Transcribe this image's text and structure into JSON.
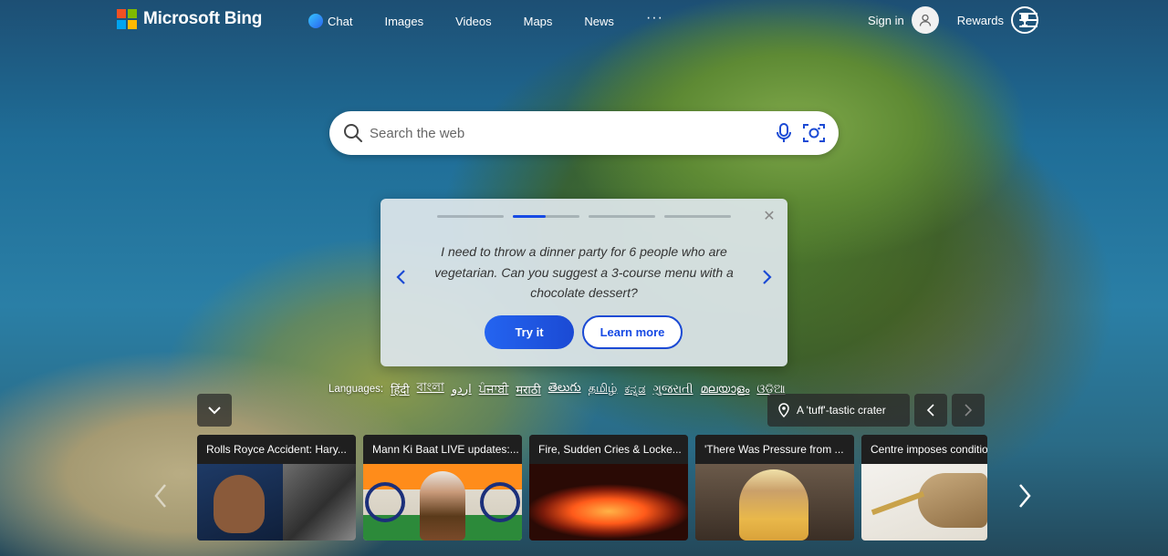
{
  "header": {
    "brand": "Microsoft Bing",
    "nav": [
      {
        "label": "Chat",
        "icon": "chat-icon"
      },
      {
        "label": "Images"
      },
      {
        "label": "Videos"
      },
      {
        "label": "Maps"
      },
      {
        "label": "News"
      },
      {
        "label": "···"
      }
    ],
    "signin_label": "Sign in",
    "rewards_label": "Rewards"
  },
  "search": {
    "placeholder": "Search the web"
  },
  "suggestion_card": {
    "text": "I need to throw a dinner party for 6 people who are vegetarian. Can you suggest a 3-course menu with a chocolate dessert?",
    "try_label": "Try it",
    "learn_label": "Learn more",
    "progress_steps": 4,
    "active_step": 2
  },
  "languages": {
    "label": "Languages:",
    "items": [
      "हिंदी",
      "বাংলা",
      "اردو",
      "ਪੰਜਾਬੀ",
      "मराठी",
      "తెలుగు",
      "தமிழ்",
      "ಕನ್ನಡ",
      "ગુજરાતી",
      "മലയാളം",
      "ଓଡ଼ିଆ"
    ]
  },
  "image_caption": "A 'tuff'-tastic crater",
  "news": [
    {
      "title": "Rolls Royce Accident: Hary..."
    },
    {
      "title": "Mann Ki Baat LIVE updates:..."
    },
    {
      "title": "Fire, Sudden Cries & Locke..."
    },
    {
      "title": "'There Was Pressure from ..."
    },
    {
      "title": "Centre imposes conditio"
    }
  ],
  "colors": {
    "accent": "#174ae4",
    "ms_red": "#f25022",
    "ms_green": "#7fba00",
    "ms_blue": "#00a4ef",
    "ms_yellow": "#ffb900"
  }
}
